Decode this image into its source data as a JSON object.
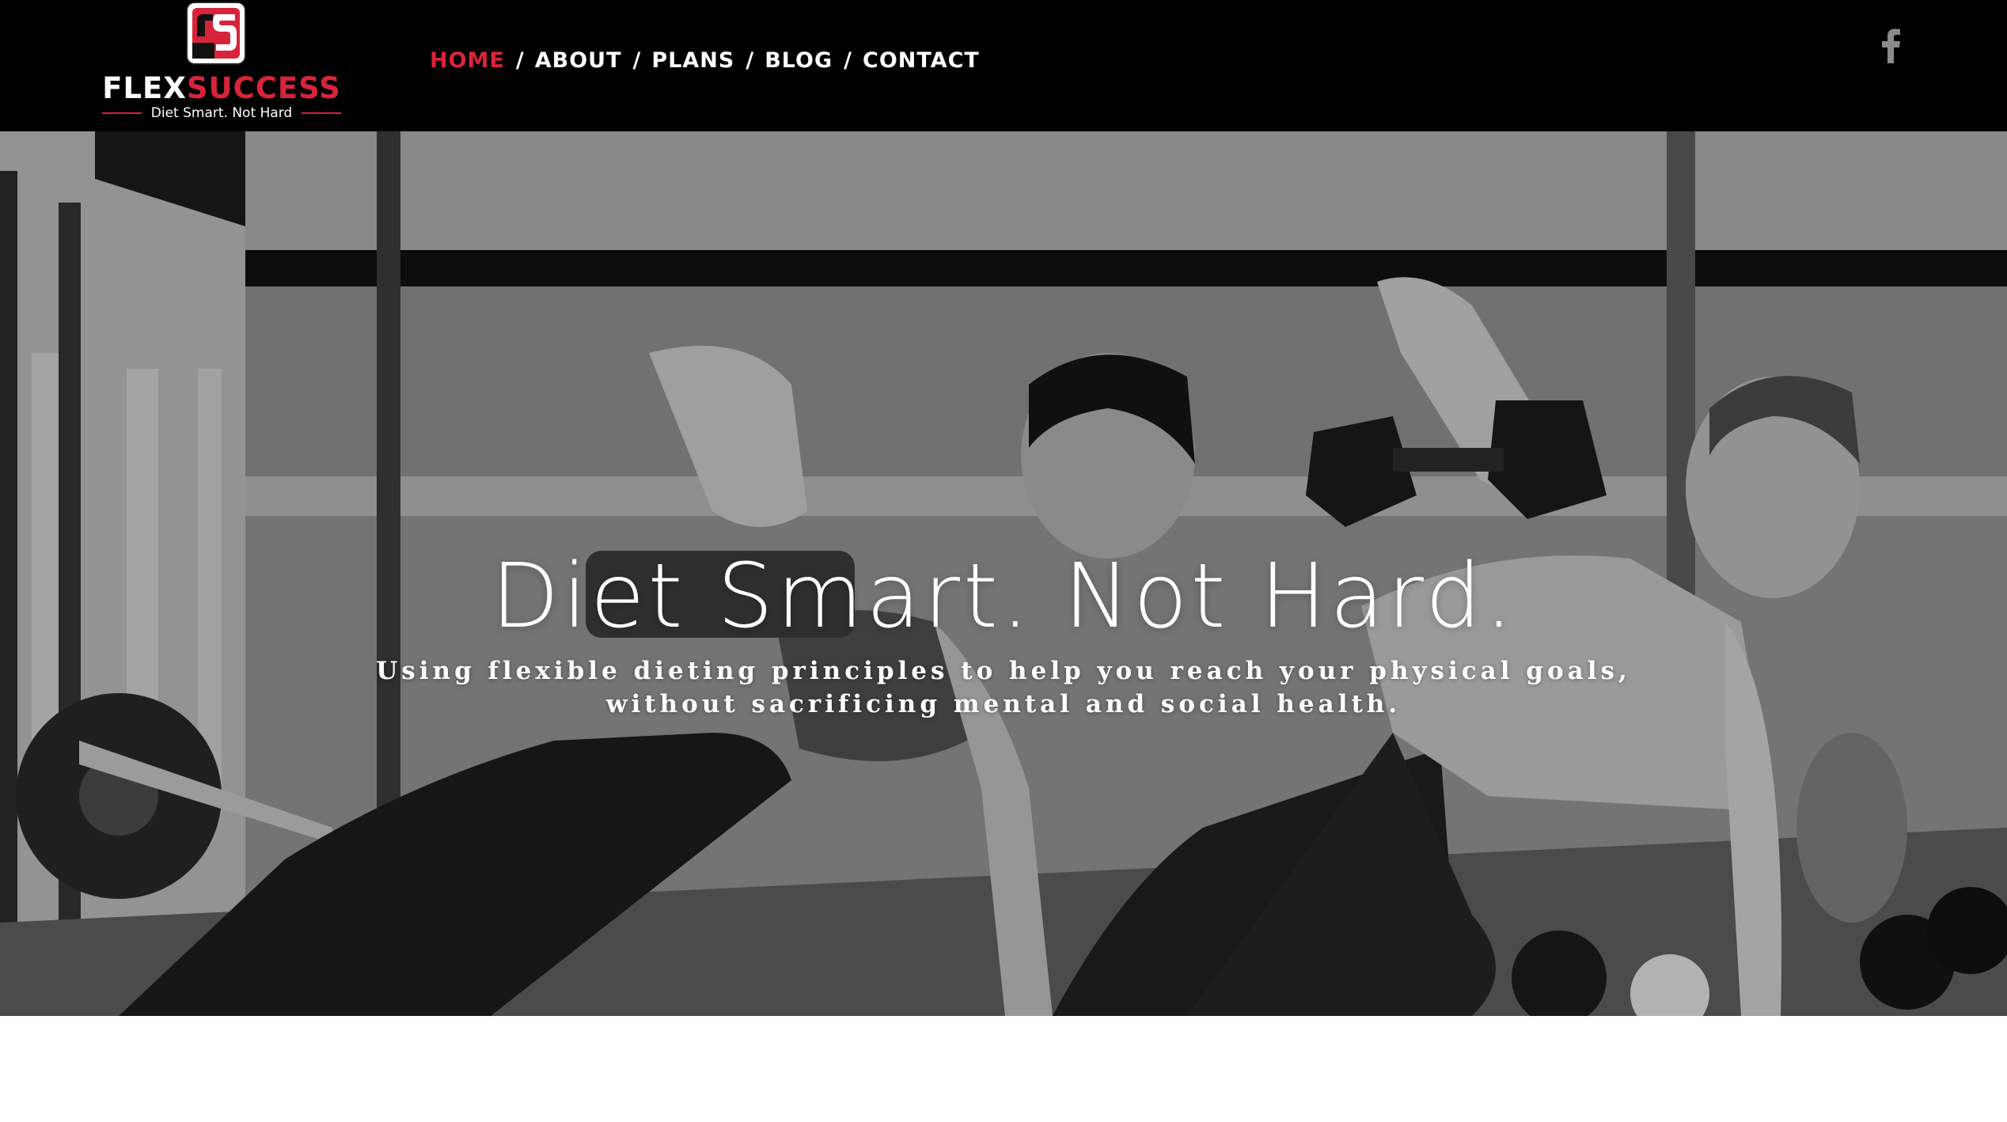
{
  "brand": {
    "name_part1": "FLEX",
    "name_part2": "SUCCESS",
    "tagline": "Diet Smart. Not Hard",
    "accent_color": "#d8243a"
  },
  "nav": {
    "items": [
      {
        "label": "HOME",
        "active": true
      },
      {
        "label": "ABOUT",
        "active": false
      },
      {
        "label": "PLANS",
        "active": false
      },
      {
        "label": "BLOG",
        "active": false
      },
      {
        "label": "CONTACT",
        "active": false
      }
    ],
    "separator": "/"
  },
  "social": {
    "icon": "facebook-icon"
  },
  "hero": {
    "title": "Diet Smart. Not Hard.",
    "subtitle_line1": "Using flexible dieting principles to help you reach your physical goals,",
    "subtitle_line2": "without sacrificing mental and social health."
  }
}
